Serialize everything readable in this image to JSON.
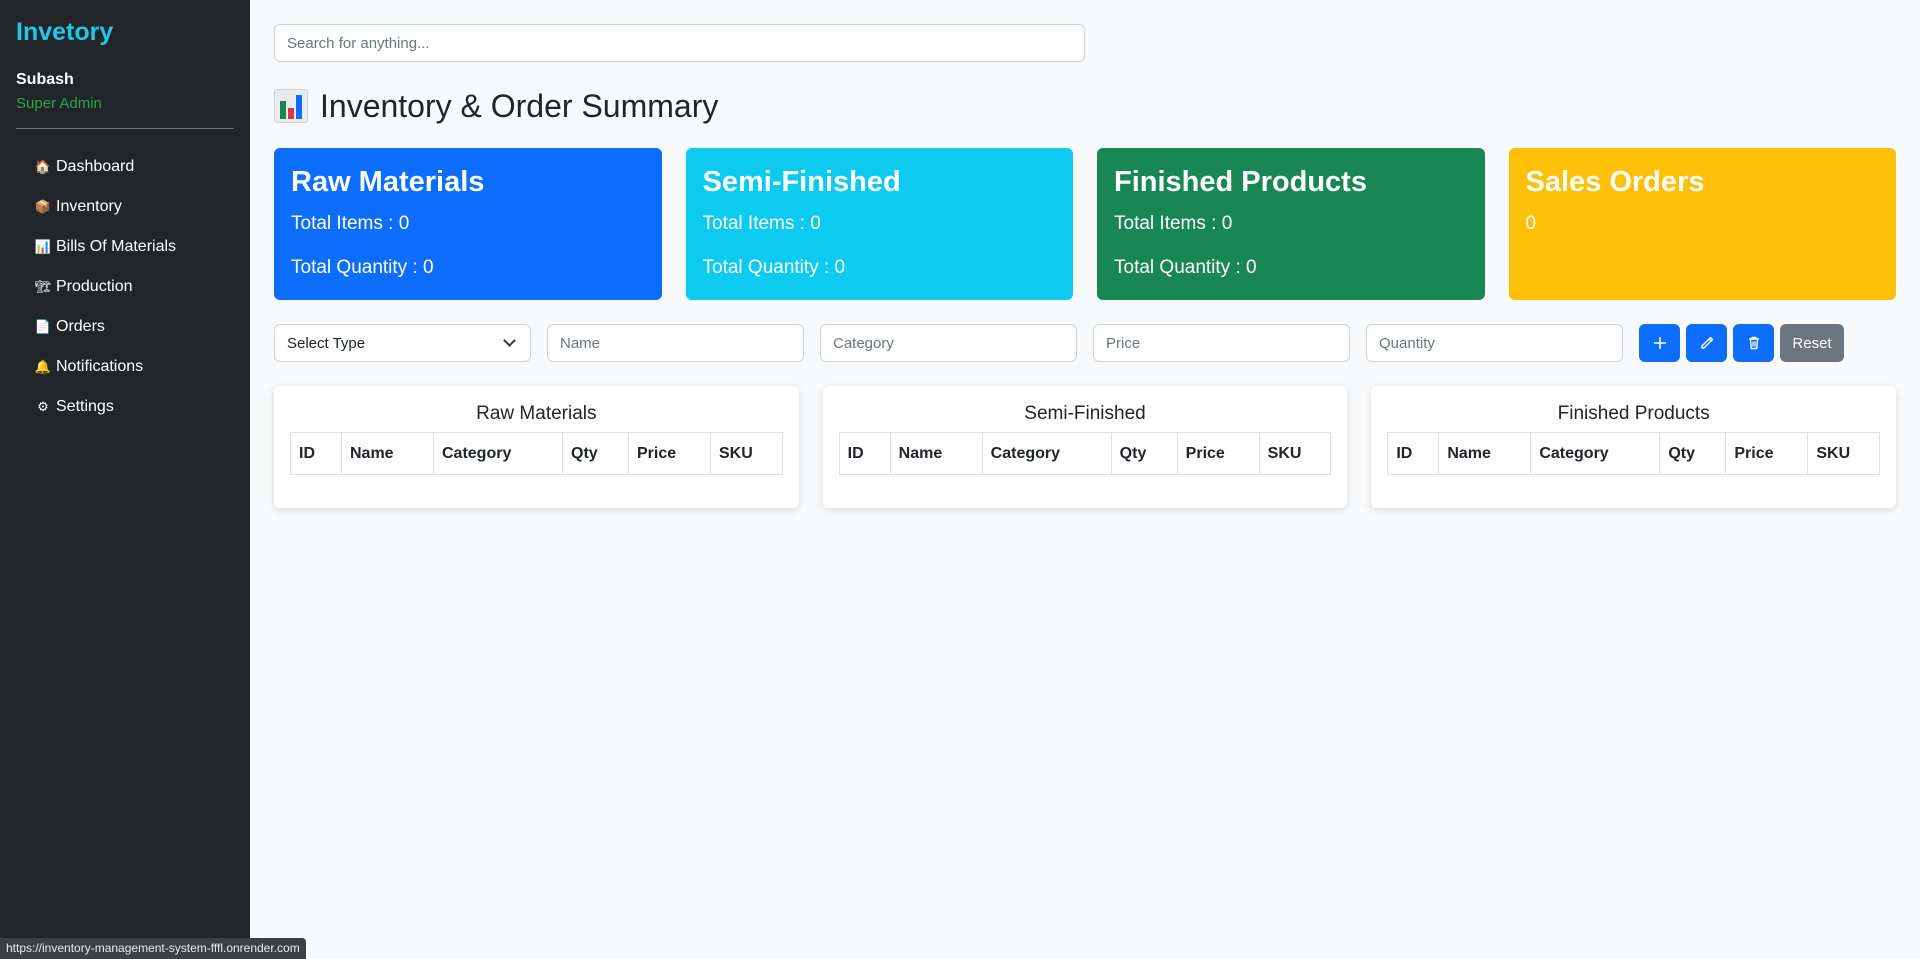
{
  "sidebar": {
    "brand": "Invetory",
    "user_name": "Subash",
    "user_role": "Super Admin",
    "items": [
      {
        "label": "Dashboard",
        "icon": "🏠",
        "icon_name": "home-icon"
      },
      {
        "label": "Inventory",
        "icon": "📦",
        "icon_name": "box-icon"
      },
      {
        "label": "Bills Of Materials",
        "icon": "📊",
        "icon_name": "chart-icon"
      },
      {
        "label": "Production",
        "icon": "🏗",
        "icon_name": "crane-icon"
      },
      {
        "label": "Orders",
        "icon": "📄",
        "icon_name": "document-icon"
      },
      {
        "label": "Notifications",
        "icon": "🔔",
        "icon_name": "bell-icon"
      },
      {
        "label": "Settings",
        "icon": "⚙",
        "icon_name": "gear-icon"
      }
    ]
  },
  "search": {
    "placeholder": "Search for anything..."
  },
  "page": {
    "title": "Inventory & Order Summary",
    "title_icon": "bar-chart-icon"
  },
  "cards": [
    {
      "title": "Raw Materials",
      "line1": "Total Items : 0",
      "line2": "Total Quantity : 0",
      "color": "#0d6efd"
    },
    {
      "title": "Semi-Finished",
      "line1": "Total Items : 0",
      "line2": "Total Quantity : 0",
      "color": "#0dcaf0"
    },
    {
      "title": "Finished Products",
      "line1": "Total Items : 0",
      "line2": "Total Quantity : 0",
      "color": "#198754"
    },
    {
      "title": "Sales Orders",
      "line1": "0",
      "color": "#ffc107"
    }
  ],
  "form": {
    "type_select": "Select Type",
    "name_placeholder": "Name",
    "category_placeholder": "Category",
    "price_placeholder": "Price",
    "quantity_placeholder": "Quantity",
    "reset_label": "Reset",
    "add_icon": "plus-icon",
    "edit_icon": "pencil-icon",
    "delete_icon": "trash-icon"
  },
  "tables": [
    {
      "title": "Raw Materials"
    },
    {
      "title": "Semi-Finished"
    },
    {
      "title": "Finished Products"
    }
  ],
  "table_columns": [
    "ID",
    "Name",
    "Category",
    "Qty",
    "Price",
    "SKU"
  ],
  "status_url": "https://inventory-management-system-fffl.onrender.com"
}
